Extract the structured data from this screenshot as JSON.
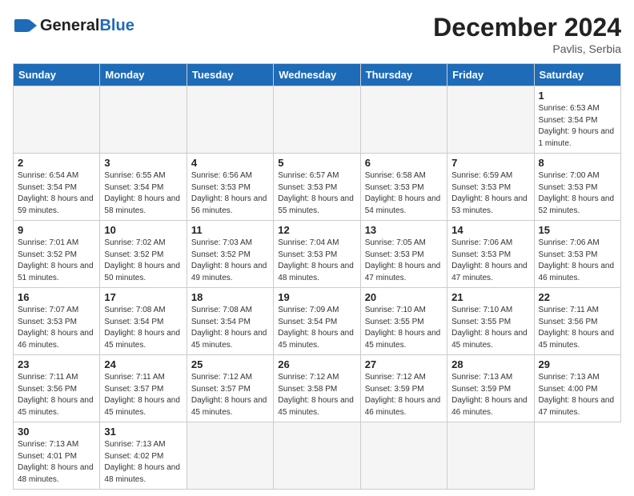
{
  "header": {
    "logo_general": "General",
    "logo_blue": "Blue",
    "month_title": "December 2024",
    "location": "Pavlis, Serbia"
  },
  "weekdays": [
    "Sunday",
    "Monday",
    "Tuesday",
    "Wednesday",
    "Thursday",
    "Friday",
    "Saturday"
  ],
  "days": [
    {
      "num": "",
      "empty": true
    },
    {
      "num": "",
      "empty": true
    },
    {
      "num": "",
      "empty": true
    },
    {
      "num": "",
      "empty": true
    },
    {
      "num": "",
      "empty": true
    },
    {
      "num": "",
      "empty": true
    },
    {
      "num": "1",
      "sunrise": "6:53 AM",
      "sunset": "3:54 PM",
      "daylight": "9 hours and 1 minute."
    },
    {
      "num": "2",
      "sunrise": "6:54 AM",
      "sunset": "3:54 PM",
      "daylight": "8 hours and 59 minutes."
    },
    {
      "num": "3",
      "sunrise": "6:55 AM",
      "sunset": "3:54 PM",
      "daylight": "8 hours and 58 minutes."
    },
    {
      "num": "4",
      "sunrise": "6:56 AM",
      "sunset": "3:53 PM",
      "daylight": "8 hours and 56 minutes."
    },
    {
      "num": "5",
      "sunrise": "6:57 AM",
      "sunset": "3:53 PM",
      "daylight": "8 hours and 55 minutes."
    },
    {
      "num": "6",
      "sunrise": "6:58 AM",
      "sunset": "3:53 PM",
      "daylight": "8 hours and 54 minutes."
    },
    {
      "num": "7",
      "sunrise": "6:59 AM",
      "sunset": "3:53 PM",
      "daylight": "8 hours and 53 minutes."
    },
    {
      "num": "8",
      "sunrise": "7:00 AM",
      "sunset": "3:53 PM",
      "daylight": "8 hours and 52 minutes."
    },
    {
      "num": "9",
      "sunrise": "7:01 AM",
      "sunset": "3:52 PM",
      "daylight": "8 hours and 51 minutes."
    },
    {
      "num": "10",
      "sunrise": "7:02 AM",
      "sunset": "3:52 PM",
      "daylight": "8 hours and 50 minutes."
    },
    {
      "num": "11",
      "sunrise": "7:03 AM",
      "sunset": "3:52 PM",
      "daylight": "8 hours and 49 minutes."
    },
    {
      "num": "12",
      "sunrise": "7:04 AM",
      "sunset": "3:53 PM",
      "daylight": "8 hours and 48 minutes."
    },
    {
      "num": "13",
      "sunrise": "7:05 AM",
      "sunset": "3:53 PM",
      "daylight": "8 hours and 47 minutes."
    },
    {
      "num": "14",
      "sunrise": "7:06 AM",
      "sunset": "3:53 PM",
      "daylight": "8 hours and 47 minutes."
    },
    {
      "num": "15",
      "sunrise": "7:06 AM",
      "sunset": "3:53 PM",
      "daylight": "8 hours and 46 minutes."
    },
    {
      "num": "16",
      "sunrise": "7:07 AM",
      "sunset": "3:53 PM",
      "daylight": "8 hours and 46 minutes."
    },
    {
      "num": "17",
      "sunrise": "7:08 AM",
      "sunset": "3:54 PM",
      "daylight": "8 hours and 45 minutes."
    },
    {
      "num": "18",
      "sunrise": "7:08 AM",
      "sunset": "3:54 PM",
      "daylight": "8 hours and 45 minutes."
    },
    {
      "num": "19",
      "sunrise": "7:09 AM",
      "sunset": "3:54 PM",
      "daylight": "8 hours and 45 minutes."
    },
    {
      "num": "20",
      "sunrise": "7:10 AM",
      "sunset": "3:55 PM",
      "daylight": "8 hours and 45 minutes."
    },
    {
      "num": "21",
      "sunrise": "7:10 AM",
      "sunset": "3:55 PM",
      "daylight": "8 hours and 45 minutes."
    },
    {
      "num": "22",
      "sunrise": "7:11 AM",
      "sunset": "3:56 PM",
      "daylight": "8 hours and 45 minutes."
    },
    {
      "num": "23",
      "sunrise": "7:11 AM",
      "sunset": "3:56 PM",
      "daylight": "8 hours and 45 minutes."
    },
    {
      "num": "24",
      "sunrise": "7:11 AM",
      "sunset": "3:57 PM",
      "daylight": "8 hours and 45 minutes."
    },
    {
      "num": "25",
      "sunrise": "7:12 AM",
      "sunset": "3:57 PM",
      "daylight": "8 hours and 45 minutes."
    },
    {
      "num": "26",
      "sunrise": "7:12 AM",
      "sunset": "3:58 PM",
      "daylight": "8 hours and 45 minutes."
    },
    {
      "num": "27",
      "sunrise": "7:12 AM",
      "sunset": "3:59 PM",
      "daylight": "8 hours and 46 minutes."
    },
    {
      "num": "28",
      "sunrise": "7:13 AM",
      "sunset": "3:59 PM",
      "daylight": "8 hours and 46 minutes."
    },
    {
      "num": "29",
      "sunrise": "7:13 AM",
      "sunset": "4:00 PM",
      "daylight": "8 hours and 47 minutes."
    },
    {
      "num": "30",
      "sunrise": "7:13 AM",
      "sunset": "4:01 PM",
      "daylight": "8 hours and 48 minutes."
    },
    {
      "num": "31",
      "sunrise": "7:13 AM",
      "sunset": "4:02 PM",
      "daylight": "8 hours and 48 minutes."
    },
    {
      "num": "",
      "empty": true
    },
    {
      "num": "",
      "empty": true
    },
    {
      "num": "",
      "empty": true
    },
    {
      "num": "",
      "empty": true
    }
  ]
}
